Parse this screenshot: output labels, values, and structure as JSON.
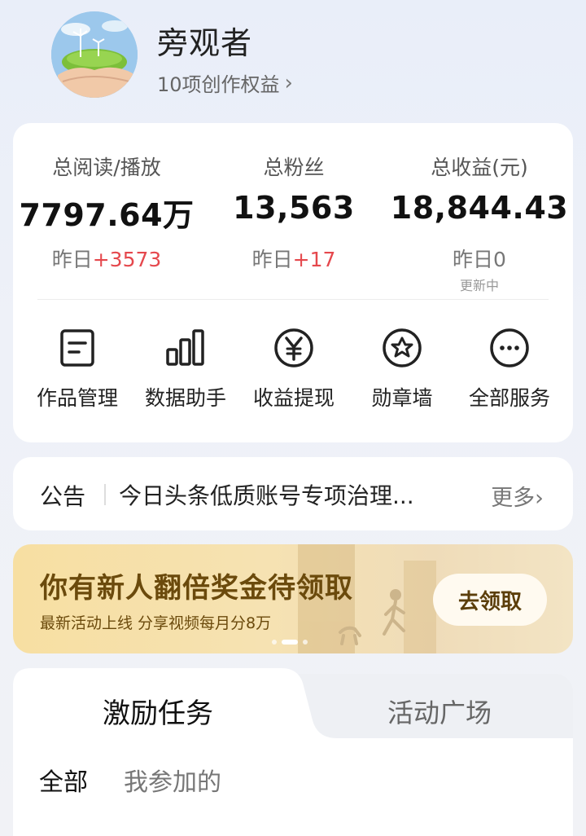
{
  "profile": {
    "username": "旁观者",
    "rights_label": "10项创作权益",
    "rights_chevron": "›"
  },
  "stats": [
    {
      "label": "总阅读/播放",
      "value": "7797.64万",
      "yesterday_prefix": "昨日",
      "yesterday_delta": "+3573",
      "note": ""
    },
    {
      "label": "总粉丝",
      "value": "13,563",
      "yesterday_prefix": "昨日",
      "yesterday_delta": "+17",
      "note": ""
    },
    {
      "label": "总收益(元)",
      "value": "18,844.43",
      "yesterday_prefix": "昨日0",
      "yesterday_delta": "",
      "note": "更新中"
    }
  ],
  "services": [
    {
      "label": "作品管理",
      "icon": "document-icon"
    },
    {
      "label": "数据助手",
      "icon": "bar-chart-icon"
    },
    {
      "label": "收益提现",
      "icon": "yen-coin-icon"
    },
    {
      "label": "勋章墙",
      "icon": "medal-icon"
    },
    {
      "label": "全部服务",
      "icon": "more-icon"
    }
  ],
  "notice": {
    "tag": "公告",
    "text": "今日头条低质账号专项治理...",
    "more": "更多›"
  },
  "banner": {
    "title": "你有新人翻倍奖金待领取",
    "subtitle": "最新活动上线 分享视频每月分8万",
    "button": "去领取"
  },
  "tabs": {
    "active": "激励任务",
    "inactive": "活动广场"
  },
  "filters": {
    "all": "全部",
    "mine": "我参加的"
  },
  "colors": {
    "delta_red": "#e5484d",
    "banner_text": "#6b4a0c",
    "background": "#eef1f8"
  }
}
